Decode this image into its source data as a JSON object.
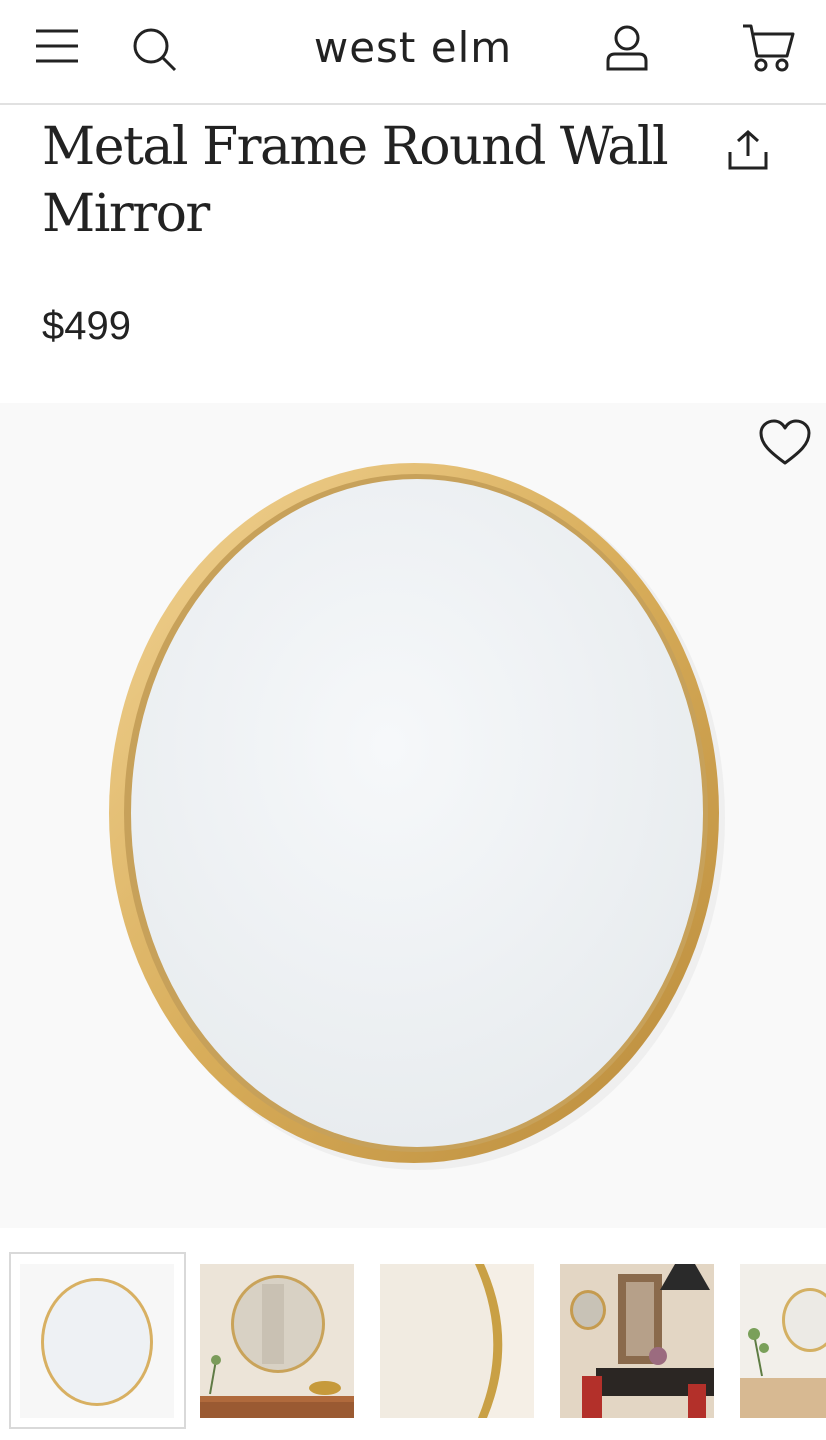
{
  "header": {
    "logo": "west elm",
    "menu_icon": "hamburger-menu-icon",
    "search_icon": "search-icon",
    "account_icon": "user-account-icon",
    "cart_icon": "shopping-cart-icon"
  },
  "product": {
    "title": "Metal Frame Round Wall Mirror",
    "price": "$499",
    "share_icon": "share-upload-icon",
    "favorite_icon": "heart-icon"
  },
  "gallery": {
    "selected_index": 0,
    "thumbnails": [
      {
        "name": "thumbnail-mirror-front"
      },
      {
        "name": "thumbnail-mirror-console-scene"
      },
      {
        "name": "thumbnail-mirror-frame-detail"
      },
      {
        "name": "thumbnail-mirror-dining-room"
      },
      {
        "name": "thumbnail-mirror-sideboard-scene"
      }
    ]
  },
  "colors": {
    "frame_gold": "#d8b062",
    "mirror_glass": "#eef1f4",
    "text": "#222222"
  }
}
